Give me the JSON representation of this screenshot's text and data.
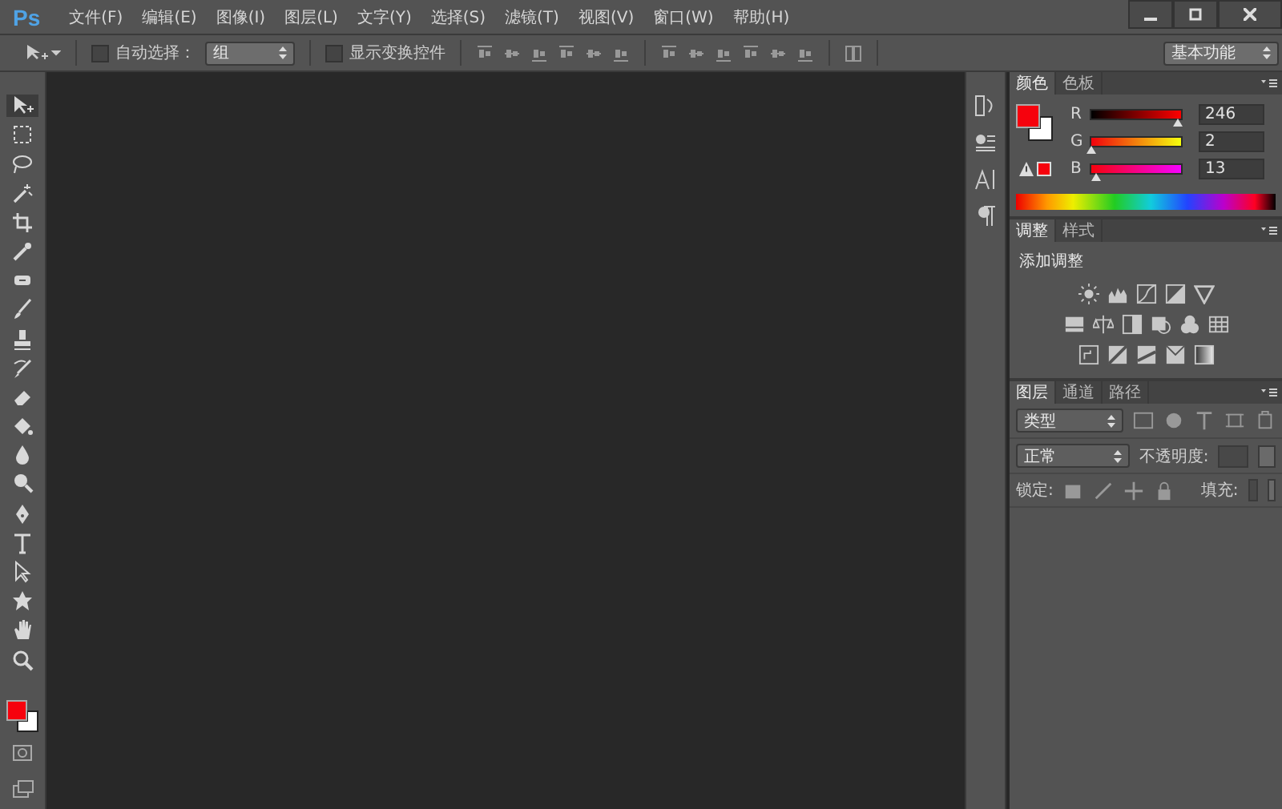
{
  "app": {
    "logo": "Ps"
  },
  "menu": [
    "文件(F)",
    "编辑(E)",
    "图像(I)",
    "图层(L)",
    "文字(Y)",
    "选择(S)",
    "滤镜(T)",
    "视图(V)",
    "窗口(W)",
    "帮助(H)"
  ],
  "options_bar": {
    "auto_select": {
      "label": "自动选择：",
      "checked": false
    },
    "auto_select_target": "组",
    "show_transform": {
      "label": "显示变换控件",
      "checked": false
    },
    "workspace": "基本功能"
  },
  "tools": [
    {
      "kind": "move",
      "selected": true
    },
    {
      "kind": "marquee",
      "selected": false
    },
    {
      "kind": "lasso",
      "selected": false
    },
    {
      "kind": "wand",
      "selected": false
    },
    {
      "kind": "crop",
      "selected": false
    },
    {
      "kind": "eyedropper",
      "selected": false
    },
    {
      "kind": "healing",
      "selected": false
    },
    {
      "kind": "brush",
      "selected": false
    },
    {
      "kind": "stamp",
      "selected": false
    },
    {
      "kind": "history",
      "selected": false
    },
    {
      "kind": "eraser",
      "selected": false
    },
    {
      "kind": "bucket",
      "selected": false
    },
    {
      "kind": "blur",
      "selected": false
    },
    {
      "kind": "dodge",
      "selected": false
    },
    {
      "kind": "pen",
      "selected": false
    },
    {
      "kind": "type",
      "selected": false
    },
    {
      "kind": "select",
      "selected": false
    },
    {
      "kind": "shape",
      "selected": false
    },
    {
      "kind": "hand",
      "selected": false
    },
    {
      "kind": "zoom",
      "selected": false
    }
  ],
  "color_panel": {
    "tabs": [
      {
        "label": "颜色",
        "selected": true
      },
      {
        "label": "色板",
        "selected": false
      }
    ],
    "channels": [
      {
        "name": "R",
        "value": "246",
        "level": 0.965
      },
      {
        "name": "G",
        "value": "2",
        "level": 0.008
      },
      {
        "name": "B",
        "value": "13",
        "level": 0.051
      }
    ]
  },
  "adjustments_panel": {
    "tabs": [
      {
        "label": "调整",
        "selected": true
      },
      {
        "label": "样式",
        "selected": false
      }
    ],
    "heading": "添加调整"
  },
  "layers_panel": {
    "tabs": [
      {
        "label": "图层",
        "selected": true
      },
      {
        "label": "通道",
        "selected": false
      },
      {
        "label": "路径",
        "selected": false
      }
    ],
    "filter": "类型",
    "blend_mode": "正常",
    "opacity_label": "不透明度:",
    "lock_label": "锁定:",
    "fill_label": "填充:"
  }
}
